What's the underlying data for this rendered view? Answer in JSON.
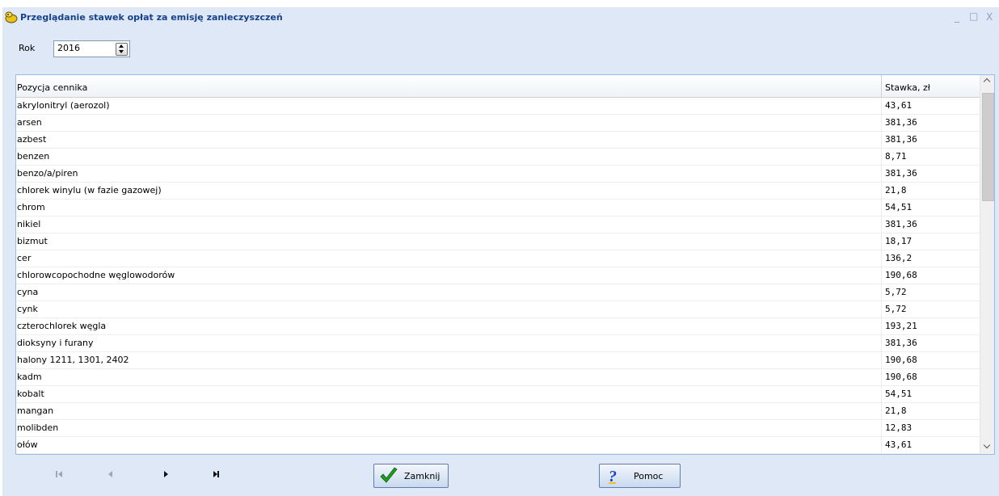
{
  "window": {
    "title": "Przeglądanie stawek opłat za emisję zanieczyszczeń",
    "minimize": "_",
    "maximize": "□",
    "close": "X"
  },
  "filter": {
    "year_label": "Rok",
    "year_value": "2016"
  },
  "grid": {
    "columns": [
      "Pozycja cennika",
      "Stawka, zł"
    ],
    "rows": [
      {
        "name": "akrylonitryl (aerozol)",
        "rate": "43,61"
      },
      {
        "name": "arsen",
        "rate": "381,36"
      },
      {
        "name": "azbest",
        "rate": "381,36"
      },
      {
        "name": "benzen",
        "rate": "8,71"
      },
      {
        "name": "benzo/a/piren",
        "rate": "381,36"
      },
      {
        "name": "chlorek winylu (w fazie gazowej)",
        "rate": "21,8"
      },
      {
        "name": "chrom",
        "rate": "54,51"
      },
      {
        "name": "nikiel",
        "rate": "381,36"
      },
      {
        "name": "bizmut",
        "rate": "18,17"
      },
      {
        "name": "cer",
        "rate": "136,2"
      },
      {
        "name": "chlorowcopochodne węglowodorów",
        "rate": "190,68"
      },
      {
        "name": "cyna",
        "rate": "5,72"
      },
      {
        "name": "cynk",
        "rate": "5,72"
      },
      {
        "name": "czterochlorek węgla",
        "rate": "193,21"
      },
      {
        "name": "dioksyny i furany",
        "rate": "381,36"
      },
      {
        "name": "halony 1211, 1301, 2402",
        "rate": "190,68"
      },
      {
        "name": "kadm",
        "rate": "190,68"
      },
      {
        "name": "kobalt",
        "rate": "54,51"
      },
      {
        "name": "mangan",
        "rate": "21,8"
      },
      {
        "name": "molibden",
        "rate": "12,83"
      },
      {
        "name": "ołów",
        "rate": "43,61"
      }
    ]
  },
  "navigation": {
    "icons": [
      "first-record-icon",
      "previous-record-icon",
      "next-record-icon",
      "last-record-icon"
    ]
  },
  "buttons": {
    "close_label": "Zamknij",
    "help_label": "Pomoc"
  },
  "colors": {
    "window_bg": "#dfe8f6",
    "title_text": "#15428b",
    "check_green": "#1f9e1f",
    "help_blue": "#1d3fc4"
  }
}
